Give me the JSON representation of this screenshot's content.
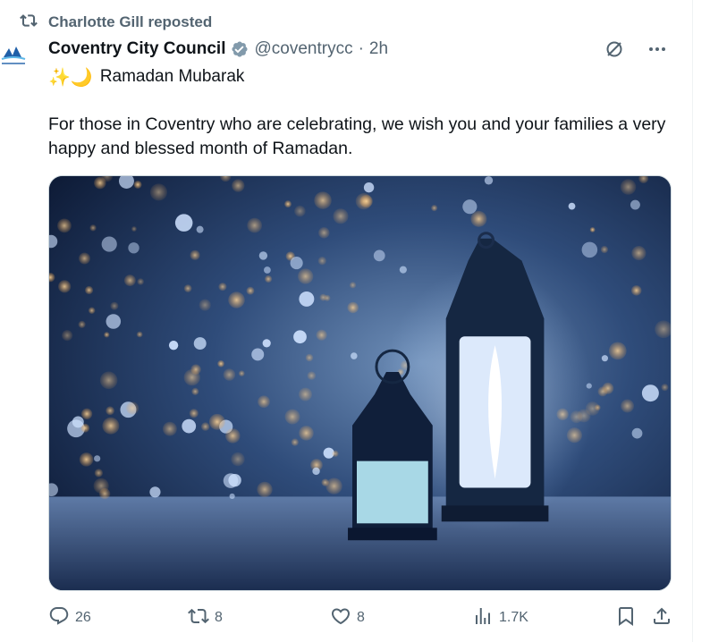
{
  "repost": {
    "icon": "repost-icon",
    "text": "Charlotte Gill reposted"
  },
  "author": {
    "avatar_icon": "coventry-city-council-logo",
    "name": "Coventry City Council",
    "verified_icon": "verified-badge-icon",
    "handle": "@coventrycc",
    "separator": "·",
    "time": "2h"
  },
  "top_actions": {
    "grok_icon": "grok-icon",
    "more_icon": "more-icon"
  },
  "post": {
    "emoji": "✨🌙",
    "title_line": "Ramadan Mubarak",
    "body": "For those in Coventry who are celebrating, we wish you and your families a very happy and blessed month of Ramadan."
  },
  "media": {
    "description_icon": "ramadan-lanterns-image"
  },
  "actions": {
    "reply_count": "26",
    "repost_count": "8",
    "like_count": "8",
    "views_count": "1.7K"
  },
  "colors": {
    "muted": "#536471",
    "text": "#0f1419",
    "verified": "#829aab",
    "border": "#cfd9de"
  }
}
